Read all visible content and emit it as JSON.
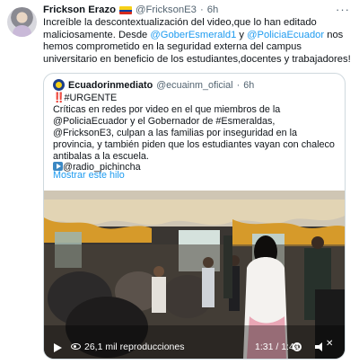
{
  "tweet": {
    "author_name": "Frickson Erazo",
    "author_handle": "@FricksonE3",
    "separator": "·",
    "time": "6h",
    "more_label": "···",
    "text_before": "Increíble la descontextualización del video,que lo han editado maliciosamente. Desde ",
    "mention_1": "@GoberEsmerald1",
    "text_middle": " y ",
    "mention_2": "@PoliciaEcuador",
    "text_after": " nos hemos comprometido en la seguridad externa del campus universitario en beneficio de los estudiantes,docentes y trabajadores!"
  },
  "quote": {
    "author_name": "Ecuadorinmediato",
    "author_handle": "@ecuainm_oficial",
    "separator": "·",
    "time": "6h",
    "bang": "‼️",
    "urgent": "#URGENTE",
    "body": "Críticas en redes por video en el que miembros de la @PoliciaEcuador y el Gobernador de #Esmeraldas, @FricksonE3, culpan a las familias por inseguridad en la provincia, y también piden que los estudiantes vayan con chaleco antibalas a la escuela.",
    "source": "@radio_pichincha",
    "show_thread": "Mostrar este hilo"
  },
  "video": {
    "views": "26,1 mil reproducciones",
    "time": "1:31 / 1:44"
  },
  "colors": {
    "link": "#1d9bf0",
    "muted": "#536471",
    "border": "#cfd9de"
  }
}
